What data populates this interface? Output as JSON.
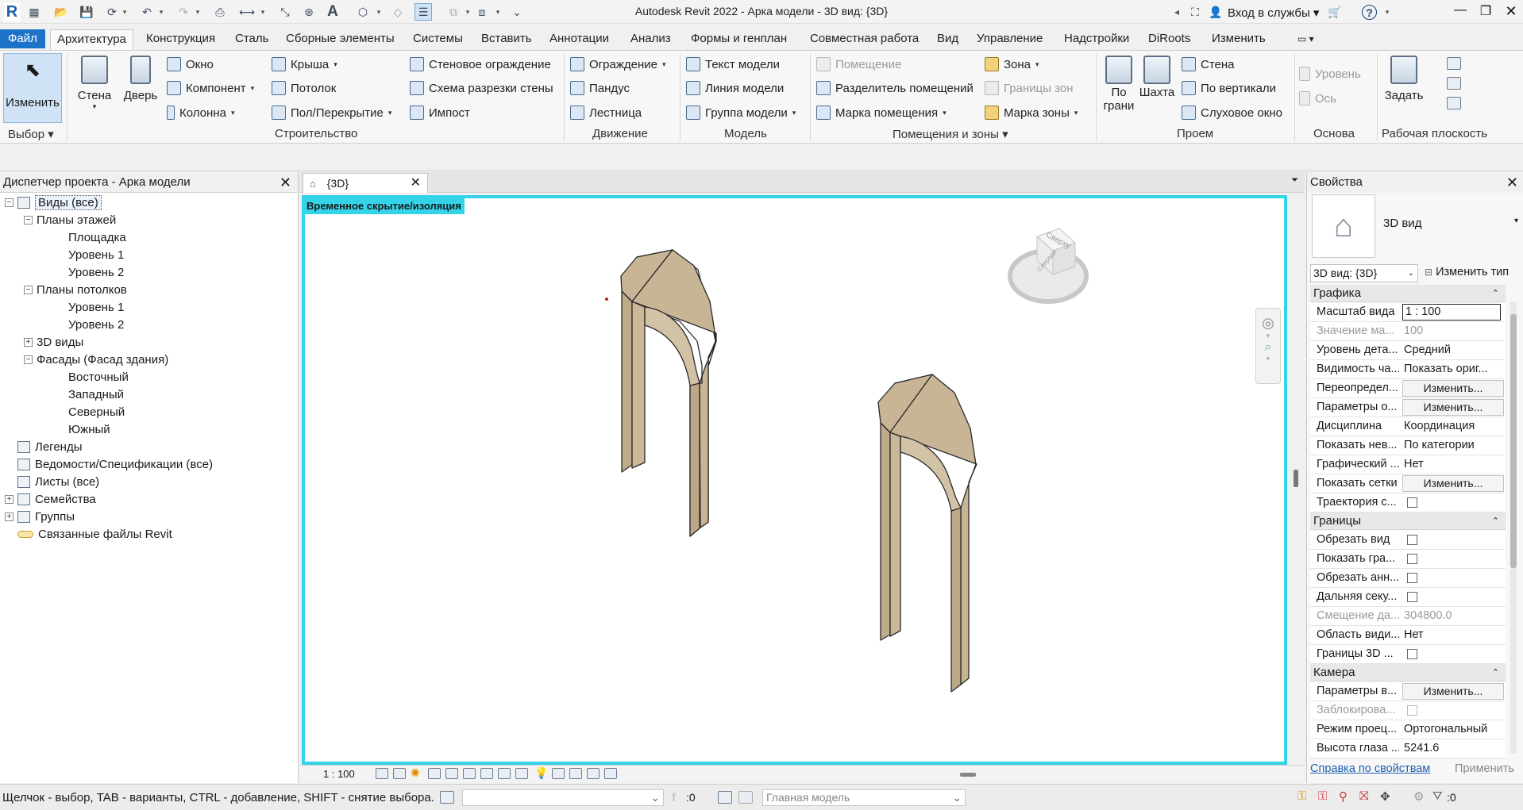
{
  "window": {
    "title": "Autodesk Revit 2022 - Арка модели - 3D вид: {3D}",
    "signin": "Вход в службы",
    "help_icon": "?"
  },
  "menu": {
    "file": "Файл",
    "tabs": [
      "Архитектура",
      "Конструкция",
      "Сталь",
      "Сборные элементы",
      "Системы",
      "Вставить",
      "Аннотации",
      "Анализ",
      "Формы и генплан",
      "Совместная работа",
      "Вид",
      "Управление",
      "Надстройки",
      "DiRoots",
      "Изменить"
    ]
  },
  "ribbon": {
    "select": {
      "modify": "Изменить",
      "panel": "Выбор"
    },
    "build": {
      "wall": "Стена",
      "door": "Дверь",
      "window": "Окно",
      "component": "Компонент",
      "column": "Колонна",
      "roof": "Крыша",
      "ceiling": "Потолок",
      "floor": "Пол/Перекрытие",
      "curtain_system": "Стеновое ограждение",
      "curtain_grid": "Схема разрезки стены",
      "mullion": "Импост",
      "panel": "Строительство"
    },
    "circulation": {
      "railing": "Ограждение",
      "ramp": "Пандус",
      "stair": "Лестница",
      "panel": "Движение"
    },
    "model": {
      "model_text": "Текст модели",
      "model_line": "Линия  модели",
      "model_group": "Группа модели",
      "panel": "Модель"
    },
    "room": {
      "room": "Помещение",
      "room_separator": "Разделитель помещений",
      "room_tag": "Марка помещения",
      "area": "Зона",
      "area_boundary": "Границы  зон",
      "area_tag": "Марка  зоны",
      "panel": "Помещения и зоны"
    },
    "opening": {
      "by_face_1": "По",
      "by_face_2": "грани",
      "shaft": "Шахта",
      "wall": "Стена",
      "vertical": "По вертикали",
      "dormer": "Слуховое окно",
      "panel": "Проем"
    },
    "datum": {
      "level": "Уровень",
      "grid": "Ось",
      "panel": "Основа"
    },
    "workplane": {
      "set": "Задать",
      "panel": "Рабочая плоскость"
    }
  },
  "browser": {
    "title": "Диспетчер проекта - Арка модели",
    "items": [
      {
        "label": "Виды (все)",
        "level": 0,
        "toggle": "−"
      },
      {
        "label": "Планы этажей",
        "level": 1,
        "toggle": "−"
      },
      {
        "label": "Площадка",
        "level": 2
      },
      {
        "label": "Уровень 1",
        "level": 2
      },
      {
        "label": "Уровень 2",
        "level": 2
      },
      {
        "label": "Планы потолков",
        "level": 1,
        "toggle": "−"
      },
      {
        "label": "Уровень 1",
        "level": 2
      },
      {
        "label": "Уровень 2",
        "level": 2
      },
      {
        "label": "3D виды",
        "level": 1,
        "toggle": "+"
      },
      {
        "label": "Фасады (Фасад здания)",
        "level": 1,
        "toggle": "−"
      },
      {
        "label": "Восточный",
        "level": 2
      },
      {
        "label": "Западный",
        "level": 2
      },
      {
        "label": "Северный",
        "level": 2
      },
      {
        "label": "Южный",
        "level": 2
      },
      {
        "label": "Легенды",
        "level": 0
      },
      {
        "label": "Ведомости/Спецификации (все)",
        "level": 0
      },
      {
        "label": "Листы (все)",
        "level": 0
      },
      {
        "label": "Семейства",
        "level": 0,
        "toggle": "+"
      },
      {
        "label": "Группы",
        "level": 0,
        "toggle": "+"
      },
      {
        "label": "Связанные файлы Revit",
        "level": 0
      }
    ]
  },
  "view": {
    "tab_label": "{3D}",
    "temp_hide": "Временное скрытие/изоляция",
    "scale": "1 : 100",
    "viewcube_top": "Сверху",
    "viewcube_front": "Спереди"
  },
  "properties": {
    "title": "Свойства",
    "type_name": "3D вид",
    "selector": "3D вид: {3D}",
    "edit_type": "Изменить тип",
    "sections": [
      {
        "name": "Графика",
        "rows": [
          {
            "name": "Масштаб вида",
            "value": "1 : 100",
            "kind": "input"
          },
          {
            "name": "Значение ма...",
            "value": "100",
            "kind": "dim"
          },
          {
            "name": "Уровень дета...",
            "value": "Средний"
          },
          {
            "name": "Видимость ча...",
            "value": "Показать ориг..."
          },
          {
            "name": "Переопредел...",
            "value": "Изменить...",
            "kind": "button"
          },
          {
            "name": "Параметры о...",
            "value": "Изменить...",
            "kind": "button"
          },
          {
            "name": "Дисциплина",
            "value": "Координация"
          },
          {
            "name": "Показать нев...",
            "value": "По категории"
          },
          {
            "name": "Графический ...",
            "value": "Нет"
          },
          {
            "name": "Показать сетки",
            "value": "Изменить...",
            "kind": "button"
          },
          {
            "name": "Траектория с...",
            "value": "",
            "kind": "check"
          }
        ]
      },
      {
        "name": "Границы",
        "rows": [
          {
            "name": "Обрезать вид",
            "value": "",
            "kind": "check"
          },
          {
            "name": "Показать гра...",
            "value": "",
            "kind": "check"
          },
          {
            "name": "Обрезать анн...",
            "value": "",
            "kind": "check"
          },
          {
            "name": "Дальняя секу...",
            "value": "",
            "kind": "check"
          },
          {
            "name": "Смещение да...",
            "value": "304800.0",
            "kind": "dim"
          },
          {
            "name": "Область види...",
            "value": "Нет"
          },
          {
            "name": "Границы 3D ...",
            "value": "",
            "kind": "check"
          }
        ]
      },
      {
        "name": "Камера",
        "rows": [
          {
            "name": "Параметры в...",
            "value": "Изменить...",
            "kind": "button"
          },
          {
            "name": "Заблокирова...",
            "value": "",
            "kind": "dimcheck"
          },
          {
            "name": "Режим проец...",
            "value": "Ортогональный"
          },
          {
            "name": "Высота глаза ...",
            "value": "5241.6"
          }
        ]
      }
    ],
    "help_link": "Справка по свойствам",
    "apply": "Применить"
  },
  "status": {
    "hint": "Щелчок - выбор, TAB - варианты, CTRL - добавление, SHIFT - снятие выбора.",
    "count": ":0",
    "model": "Главная модель",
    "filter_count": ":0"
  },
  "colors": {
    "accent": "#1e73c9",
    "viewport_border": "#34d3e8",
    "arch_fill": "#c8b596",
    "arch_top": "#cdbb9c",
    "arch_side": "#bba682"
  }
}
